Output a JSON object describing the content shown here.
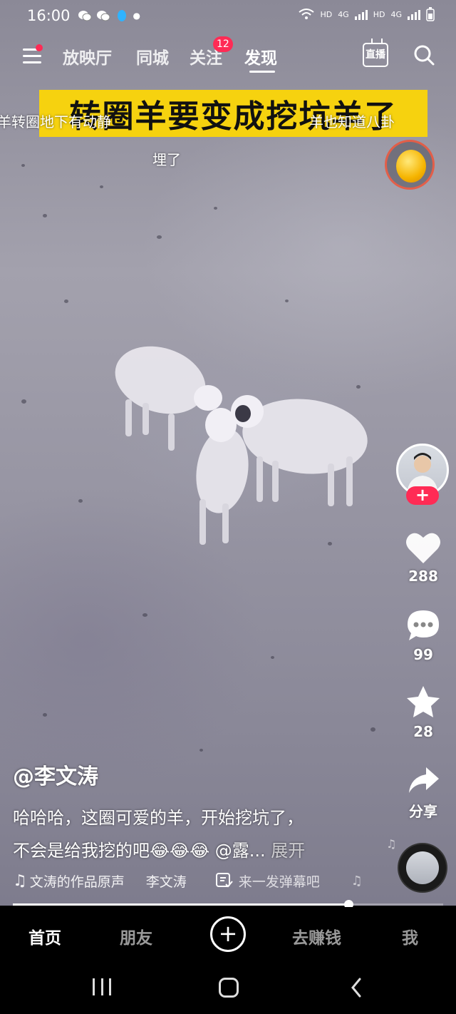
{
  "status_bar": {
    "time": "16:00",
    "network_labels": [
      "HD",
      "4G",
      "HD",
      "4G"
    ]
  },
  "top_nav": {
    "tabs": [
      {
        "label": "放映厅",
        "active": false
      },
      {
        "label": "同城",
        "active": false
      },
      {
        "label": "关注",
        "active": false
      },
      {
        "label": "发现",
        "active": true
      }
    ],
    "follow_badge": "12",
    "live_label": "直播",
    "icons": [
      "menu-icon",
      "live-icon",
      "search-icon"
    ]
  },
  "video": {
    "caption_banner": "转圈羊要变成挖坑羊了",
    "danmaku": [
      "羊转圈地下有动静",
      "羊也知道八卦",
      "埋了"
    ]
  },
  "actions": {
    "like_count": "288",
    "comment_count": "99",
    "favorite_count": "28",
    "share_label": "分享"
  },
  "post": {
    "author": "@李文涛",
    "description_line1": "哈哈哈，这圈可爱的羊，开始挖坑了，",
    "description_line2": "不会是给我挖的吧😂😂😂 @露...",
    "expand_label": "展开",
    "music": "文涛的作品原声",
    "music_author": "李文涛",
    "danmaku_prompt": "来一发弹幕吧"
  },
  "playback": {
    "progress": 0.78
  },
  "bottom_tabs": [
    {
      "label": "首页",
      "active": true
    },
    {
      "label": "朋友",
      "active": false
    },
    {
      "label": "去赚钱",
      "active": false
    },
    {
      "label": "我",
      "active": false
    }
  ],
  "colors": {
    "accent": "#ff2b55",
    "banner": "#f6d20f"
  }
}
